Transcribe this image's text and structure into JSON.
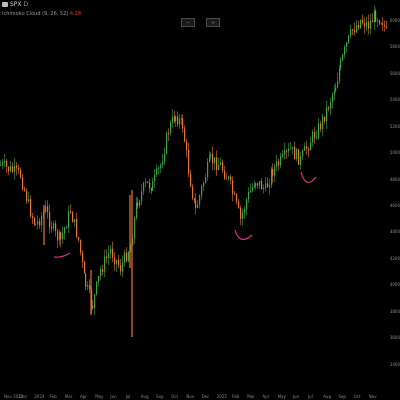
{
  "header": {
    "symbol": "SPX",
    "symbol_suffix": "D",
    "study_text": "Ichimoku Cloud (9, 26, 52)",
    "study_value": "4.28"
  },
  "zoom_controls": {
    "zoom_out_label": "−",
    "zoom_in_label": "+"
  },
  "time_axis": {
    "labels": [
      "Nov 2023",
      "Dec",
      "2024",
      "Feb",
      "Mar",
      "Apr",
      "May",
      "Jun",
      "Jul",
      "Aug",
      "Sep",
      "Oct",
      "Nov",
      "Dec",
      "2025",
      "Feb",
      "Mar",
      "Apr",
      "May",
      "Jun",
      "Jul",
      "Aug",
      "Sep",
      "Oct",
      "Nov"
    ]
  },
  "price_axis": {
    "labels": [
      "6000",
      "5800",
      "5600",
      "5400",
      "5200",
      "5000",
      "4800",
      "4600",
      "4400",
      "4200",
      "4000",
      "3800",
      "3600",
      "3400"
    ]
  },
  "colors": {
    "background": "#000000",
    "up_candle": "#3aa64a",
    "down_candle": "#e8762a",
    "annotation": "#d63384",
    "text": "#9a9a9a"
  },
  "annotations": [
    "curve-1",
    "curve-2",
    "curve-3"
  ]
}
